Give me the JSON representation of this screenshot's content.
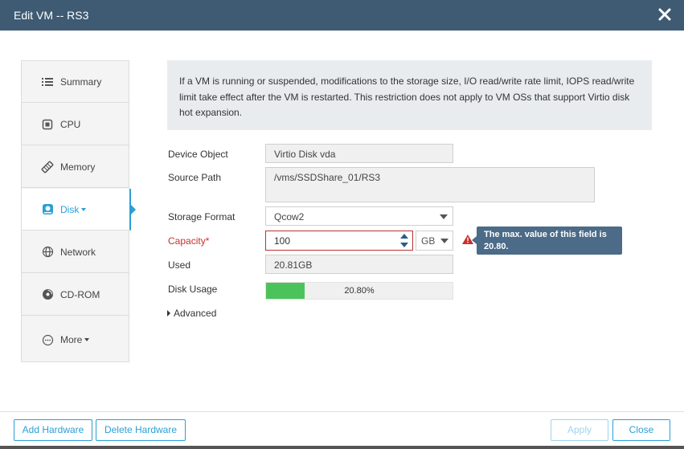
{
  "dialog": {
    "title": "Edit VM -- RS3"
  },
  "nav": {
    "items": [
      {
        "label": "Summary",
        "icon": "list-icon"
      },
      {
        "label": "CPU",
        "icon": "cpu-icon"
      },
      {
        "label": "Memory",
        "icon": "memory-icon"
      },
      {
        "label": "Disk",
        "icon": "disk-icon",
        "active": true
      },
      {
        "label": "Network",
        "icon": "globe-icon"
      },
      {
        "label": "CD-ROM",
        "icon": "cdrom-icon"
      },
      {
        "label": "More",
        "icon": "more-icon"
      }
    ]
  },
  "notice": {
    "text": "If a VM is running or suspended, modifications to the storage size, I/O read/write rate limit, IOPS read/write limit take effect after the VM is restarted. This restriction does not apply to VM OSs that support Virtio disk hot expansion."
  },
  "form": {
    "device_object": {
      "label": "Device Object",
      "value": "Virtio Disk vda"
    },
    "source_path": {
      "label": "Source Path",
      "value": "/vms/SSDShare_01/RS3"
    },
    "storage_format": {
      "label": "Storage Format",
      "value": "Qcow2"
    },
    "capacity": {
      "label": "Capacity*",
      "value": "100",
      "unit": "GB",
      "tooltip": "The max. value of this field is 20.80."
    },
    "used": {
      "label": "Used",
      "value": "20.81GB"
    },
    "disk_usage": {
      "label": "Disk Usage",
      "percent_text": "20.80%",
      "fraction": 0.208,
      "fill_color": "#4cc35a"
    },
    "advanced": {
      "label": "Advanced"
    }
  },
  "footer": {
    "add_hardware": "Add Hardware",
    "delete_hardware": "Delete Hardware",
    "apply": "Apply",
    "close": "Close"
  },
  "colors": {
    "titlebar": "#3e5b73",
    "accent": "#2a9fd6",
    "error": "#c9302c",
    "tooltip": "#4b6b88"
  }
}
